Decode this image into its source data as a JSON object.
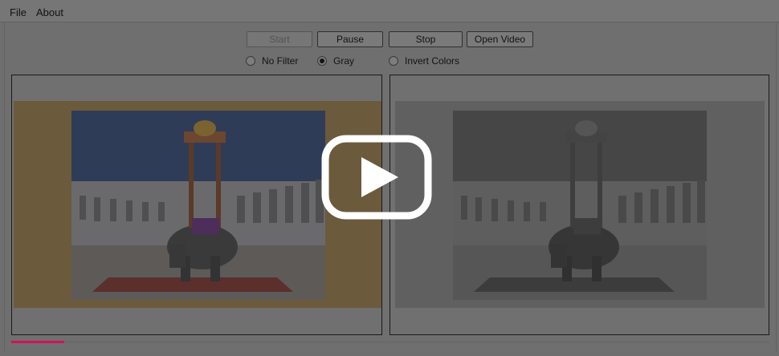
{
  "menu": {
    "file": "File",
    "about": "About"
  },
  "controls": {
    "start": "Start",
    "start_enabled": false,
    "pause": "Pause",
    "stop": "Stop",
    "open_video": "Open Video"
  },
  "filters": {
    "options": [
      "No Filter",
      "Gray",
      "Invert Colors"
    ],
    "selected": "Gray"
  },
  "video": {
    "original_frame": "elephant-clock-scene",
    "filtered_frame": "elephant-clock-scene-gray"
  },
  "playback": {
    "progress_fraction": 0.07
  },
  "overlay": {
    "icon": "play-icon"
  },
  "colors": {
    "progress": "#d4115a"
  }
}
